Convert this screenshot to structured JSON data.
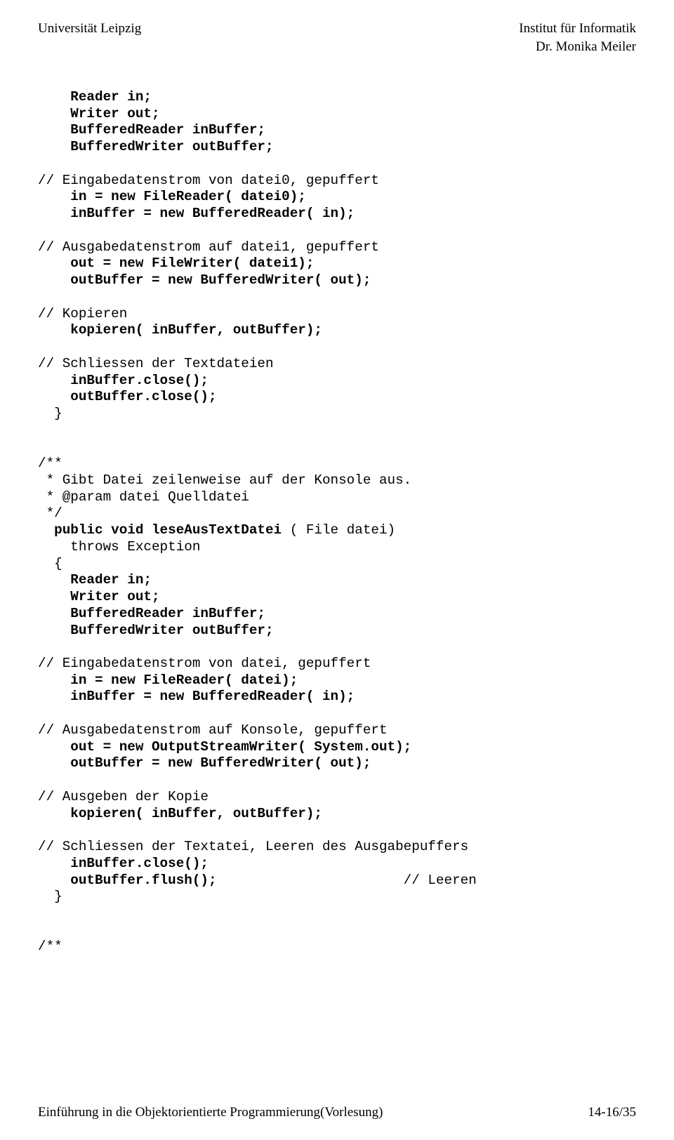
{
  "header": {
    "left": "Universität Leipzig",
    "right1": "Institut für Informatik",
    "right2": "Dr. Monika Meiler"
  },
  "code": {
    "l01": "    Reader in;",
    "l02": "    Writer out;",
    "l03": "    BufferedReader inBuffer;",
    "l04": "    BufferedWriter outBuffer;",
    "l05": "// Eingabedatenstrom von datei0, gepuffert",
    "l06": "    in = new FileReader( datei0);",
    "l07": "    inBuffer = new BufferedReader( in);",
    "l08": "// Ausgabedatenstrom auf datei1, gepuffert",
    "l09": "    out = new FileWriter( datei1);",
    "l10": "    outBuffer = new BufferedWriter( out);",
    "l11": "// Kopieren",
    "l12": "    kopieren( inBuffer, outBuffer);",
    "l13": "// Schliessen der Textdateien",
    "l14": "    inBuffer.close();",
    "l15": "    outBuffer.close();",
    "l16": "  }",
    "l17": "/**",
    "l18": " * Gibt Datei zeilenweise auf der Konsole aus.",
    "l19": " * @param datei Quelldatei",
    "l20": " */",
    "l21a": "  public void leseAusTextDatei",
    "l21b": " ( File datei)",
    "l22": "    throws Exception",
    "l23": "  {",
    "l24": "    Reader in;",
    "l25": "    Writer out;",
    "l26": "    BufferedReader inBuffer;",
    "l27": "    BufferedWriter outBuffer;",
    "l28": "// Eingabedatenstrom von datei, gepuffert",
    "l29": "    in = new FileReader( datei);",
    "l30": "    inBuffer = new BufferedReader( in);",
    "l31": "// Ausgabedatenstrom auf Konsole, gepuffert",
    "l32": "    out = new OutputStreamWriter( System.out);",
    "l33": "    outBuffer = new BufferedWriter( out);",
    "l34": "// Ausgeben der Kopie",
    "l35": "    kopieren( inBuffer, outBuffer);",
    "l36": "// Schliessen der Textatei, Leeren des Ausgabepuffers",
    "l37": "    inBuffer.close();",
    "l38a": "    outBuffer.flush();",
    "l38b": "                       // Leeren",
    "l39": "  }",
    "l40": "/**"
  },
  "footer": {
    "left": "Einführung in die Objektorientierte Programmierung(Vorlesung)",
    "right": "14-16/35"
  }
}
